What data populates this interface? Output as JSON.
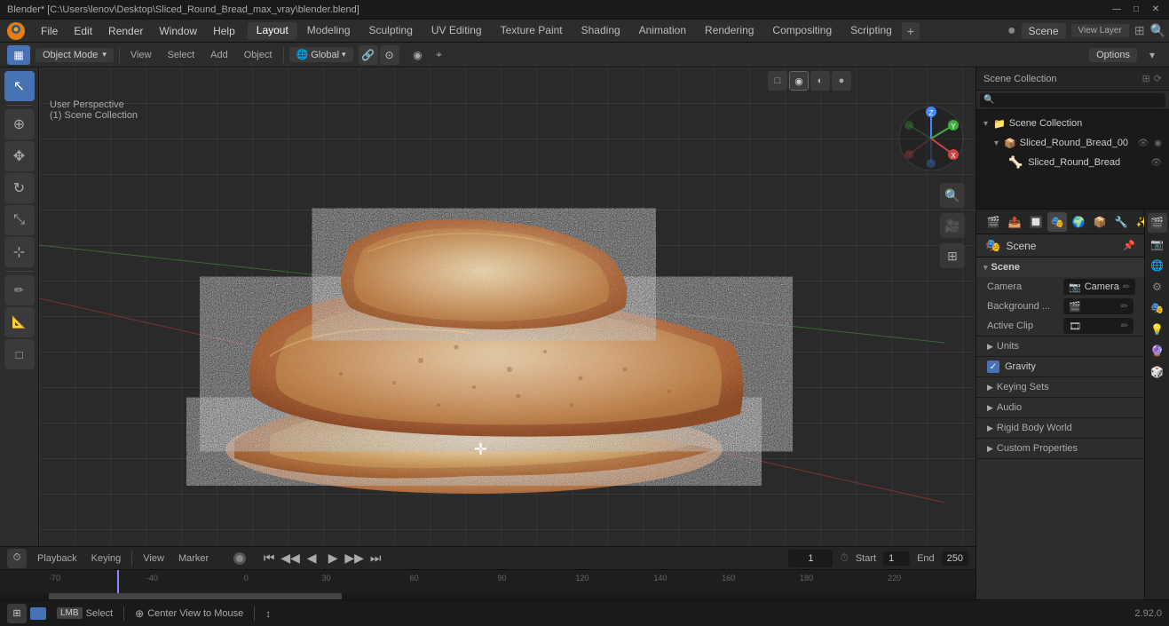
{
  "titlebar": {
    "title": "Blender* [C:\\Users\\lenov\\Desktop\\Sliced_Round_Bread_max_vray\\blender.blend]",
    "controls": [
      "—",
      "□",
      "✕"
    ]
  },
  "menubar": {
    "items": [
      "File",
      "Edit",
      "Render",
      "Window",
      "Help"
    ],
    "workspaces": [
      "Layout",
      "Modeling",
      "Sculpting",
      "UV Editing",
      "Texture Paint",
      "Shading",
      "Animation",
      "Rendering",
      "Compositing",
      "Scripting"
    ],
    "active_workspace": "Layout",
    "plus_label": "+",
    "right": {
      "icon": "●",
      "scene_name": "Scene",
      "view_layer": "View Layer",
      "icons": [
        "⊞",
        "🔍"
      ]
    }
  },
  "viewport": {
    "mode": "Object Mode",
    "view_menu": "View",
    "select_menu": "Select",
    "add_menu": "Add",
    "object_menu": "Object",
    "transform": "Global",
    "perspective_label": "User Perspective",
    "collection_label": "(1) Scene Collection",
    "options_label": "Options"
  },
  "outliner": {
    "title": "Scene Collection",
    "search_placeholder": "Search",
    "items": [
      {
        "indent": 0,
        "icon": "📁",
        "label": "Scene Collection",
        "eye": true
      },
      {
        "indent": 1,
        "icon": "📦",
        "label": "Sliced_Round_Bread_00",
        "eye": true
      },
      {
        "indent": 2,
        "icon": "🔶",
        "label": "Sliced_Round_Bread",
        "eye": true
      }
    ]
  },
  "properties": {
    "title": "Scene",
    "sections": {
      "scene": {
        "label": "Scene",
        "camera_label": "Camera",
        "camera_value": "Camera",
        "background_label": "Background ...",
        "active_clip_label": "Active Clip",
        "units_label": "Units",
        "gravity_label": "Gravity",
        "gravity_checked": true,
        "keying_sets_label": "Keying Sets",
        "audio_label": "Audio",
        "rigid_body_label": "Rigid Body World",
        "custom_props_label": "Custom Properties"
      }
    },
    "side_icons": [
      "🎬",
      "📷",
      "🌐",
      "⚙",
      "🎭",
      "💡",
      "🔮",
      "🎲"
    ]
  },
  "timeline": {
    "playback_label": "Playback",
    "keying_label": "Keying",
    "view_label": "View",
    "marker_label": "Marker",
    "record_btn": "⏺",
    "transport": [
      "⏮",
      "◀◀",
      "◀",
      "▶",
      "▶▶",
      "⏭"
    ],
    "current_frame": "1",
    "start_label": "Start",
    "start_value": "1",
    "end_label": "End",
    "end_value": "250",
    "ticks": [
      {
        "pos": "5%",
        "label": "-70"
      },
      {
        "pos": "15%",
        "label": "-40"
      },
      {
        "pos": "25%",
        "label": "0"
      },
      {
        "pos": "35%",
        "label": "30"
      },
      {
        "pos": "45%",
        "label": "60"
      },
      {
        "pos": "55%",
        "label": "90"
      },
      {
        "pos": "63%",
        "label": "120"
      },
      {
        "pos": "71%",
        "label": "140"
      },
      {
        "pos": "79%",
        "label": "160"
      },
      {
        "pos": "87%",
        "label": "180"
      },
      {
        "pos": "95%",
        "label": "220"
      }
    ]
  },
  "statusbar": {
    "select_label": "Select",
    "select_key": "LMB",
    "center_view_label": "Center View to Mouse",
    "center_view_key": "MMB",
    "version": "2.92.0"
  }
}
